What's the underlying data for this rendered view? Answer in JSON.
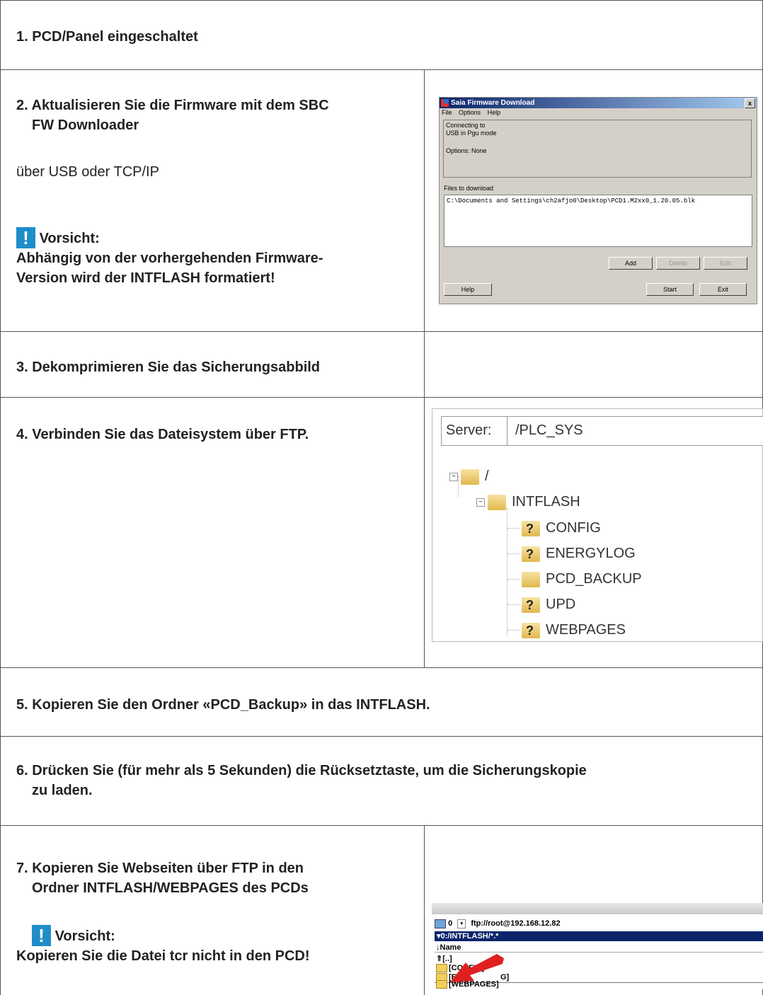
{
  "steps": {
    "s1": "1. PCD/Panel eingeschaltet",
    "s2_title_line1": "2. Aktualisieren Sie die Firmware mit dem SBC",
    "s2_title_line2": "FW Downloader",
    "s2_sub": "über USB oder TCP/IP",
    "s2_warn_label": "Vorsicht:",
    "s2_warn_line1": "Abhängig von der vorhergehenden Firmware-",
    "s2_warn_line2": "Version wird der INTFLASH formatiert!",
    "s3": "3. Dekomprimieren Sie das Sicherungsabbild",
    "s4": "4. Verbinden Sie das Dateisystem über FTP.",
    "s5": "5. Kopieren Sie den Ordner «PCD_Backup» in das INTFLASH.",
    "s6_line1": "6. Drücken Sie (für mehr als 5 Sekunden) die Rücksetztaste, um die Sicherungskopie",
    "s6_line2": "zu laden.",
    "s7_line1": "7. Kopieren Sie Webseiten über FTP in den",
    "s7_line2": "Ordner INTFLASH/WEBPAGES des PCDs",
    "s7_warn_label": "Vorsicht:",
    "s7_warn_text": "Kopieren Sie die Datei tcr nicht in den PCD!",
    "warn_glyph": "!"
  },
  "fw_window": {
    "title": "Saia Firmware Download",
    "close": "x",
    "menu": [
      "File",
      "Options",
      "Help"
    ],
    "status_line1": "Connecting to",
    "status_line2": "USB in Pgu mode",
    "options": "Options: None",
    "files_label": "Files to download",
    "file_path": "C:\\Documents and Settings\\ch2afjo0\\Desktop\\PCD1.M2xx0_1.20.05.blk",
    "buttons": {
      "add": "Add",
      "delete": "Delete",
      "edit": "Edit",
      "help": "Help",
      "start": "Start",
      "exit": "Exit"
    }
  },
  "ftp_tree": {
    "server_label": "Server:",
    "server_value": "/PLC_SYS",
    "root": "/",
    "intflash": "INTFLASH",
    "children": [
      {
        "name": "CONFIG",
        "unknown": true
      },
      {
        "name": "ENERGYLOG",
        "unknown": true
      },
      {
        "name": "PCD_BACKUP",
        "unknown": false
      },
      {
        "name": "UPD",
        "unknown": true
      },
      {
        "name": "WEBPAGES",
        "unknown": true
      }
    ],
    "unknown_glyph": "?",
    "expand_glyph": "−"
  },
  "tc_panel": {
    "drive": "0",
    "drive_dropdown": "▾",
    "url": "ftp://root@192.168.12.82",
    "path": "▾0:/INTFLASH/*.*",
    "column": "↓Name",
    "items": [
      "[..]",
      "[CONFIG]",
      "[EN",
      "G]",
      "[WEBPAGES]"
    ]
  },
  "colors": {
    "warning_icon": "#1f8dc9",
    "arrow": "#e02020",
    "title_bar": "#0a246a"
  }
}
